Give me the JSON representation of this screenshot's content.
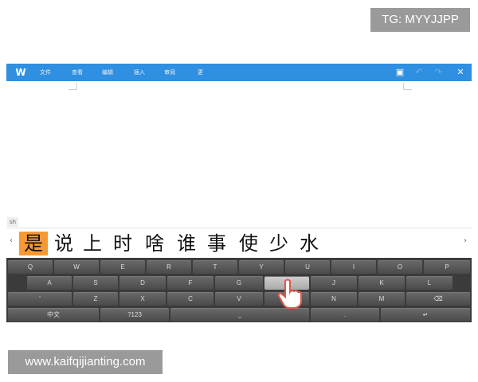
{
  "watermarks": {
    "top": "TG: MYYJJPP",
    "bottom": "www.kaifqijianting.com"
  },
  "toolbar": {
    "menu": [
      "文件",
      "查看",
      "编辑",
      "插入",
      "审阅",
      "更"
    ],
    "icons": [
      "save-icon",
      "undo-icon",
      "redo-icon",
      "close-icon"
    ]
  },
  "ime": {
    "label": "sh",
    "candidates": [
      "是",
      "说",
      "上",
      "时",
      "啥",
      "谁",
      "事",
      "使",
      "少",
      "水"
    ],
    "selected_index": 0
  },
  "keyboard": {
    "row1": [
      "Q",
      "W",
      "E",
      "R",
      "T",
      "Y",
      "U",
      "I",
      "O",
      "P"
    ],
    "row2": [
      "A",
      "S",
      "D",
      "F",
      "G",
      "H",
      "J",
      "K",
      "L"
    ],
    "row3": [
      "'",
      "Z",
      "X",
      "C",
      "V",
      "B",
      "N",
      "M"
    ],
    "row4": {
      "lang": "中文",
      "num": "?123",
      "period": "."
    }
  },
  "colors": {
    "toolbar": "#2f8fe0",
    "selected_candidate": "#f59a33",
    "keyboard_bg": "#3b3b3b"
  }
}
